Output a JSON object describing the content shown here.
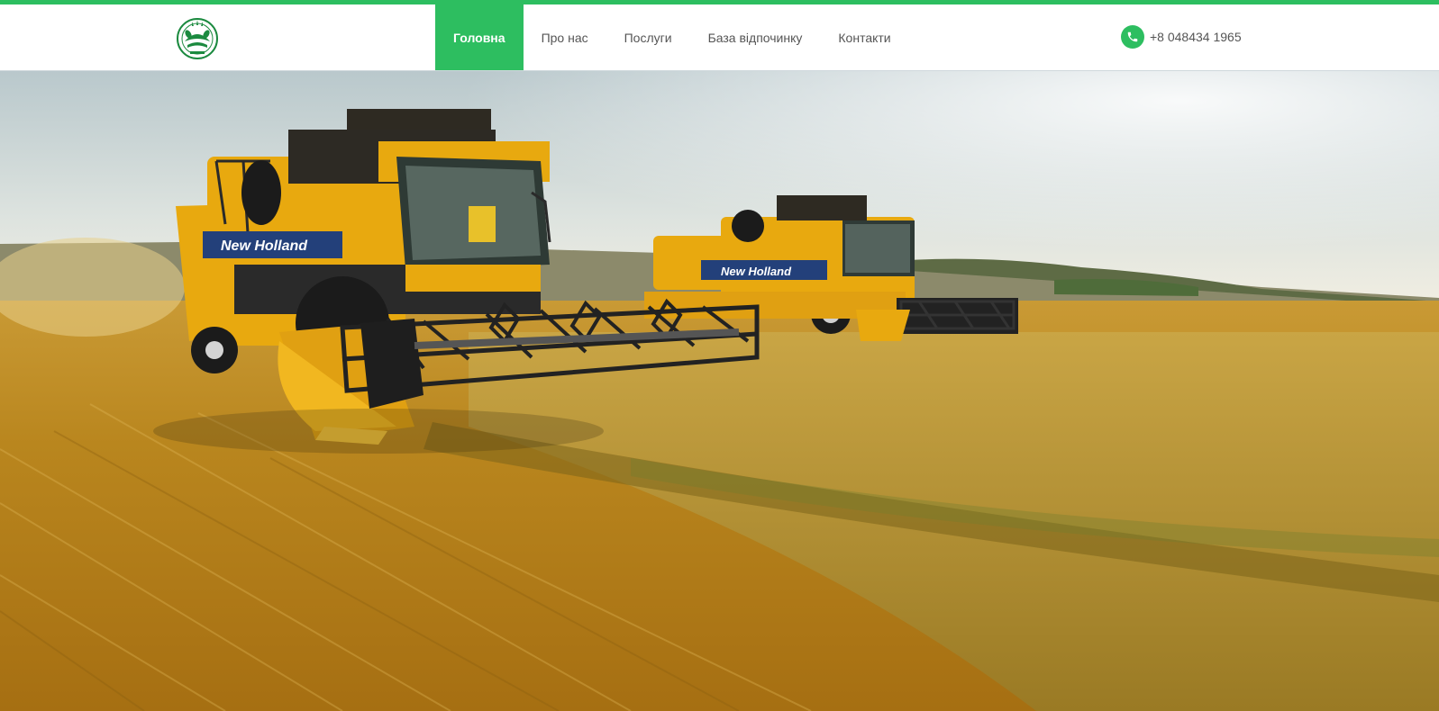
{
  "nav": {
    "items": [
      {
        "label": "Головна",
        "active": true
      },
      {
        "label": "Про нас",
        "active": false
      },
      {
        "label": "Послуги",
        "active": false
      },
      {
        "label": "База відпочинку",
        "active": false
      },
      {
        "label": "Контакти",
        "active": false
      }
    ]
  },
  "contact": {
    "phone": "+8 048434 1965",
    "icon": "phone-icon"
  },
  "logo": {
    "icon": "emblem-logo"
  },
  "hero": {
    "combine_brand_1": "New Holland",
    "combine_brand_2": "New Holland"
  },
  "colors": {
    "accent": "#2dbe60",
    "nav_text": "#555555",
    "combine_yellow": "#e8a90f",
    "brand_panel": "#23407a"
  }
}
